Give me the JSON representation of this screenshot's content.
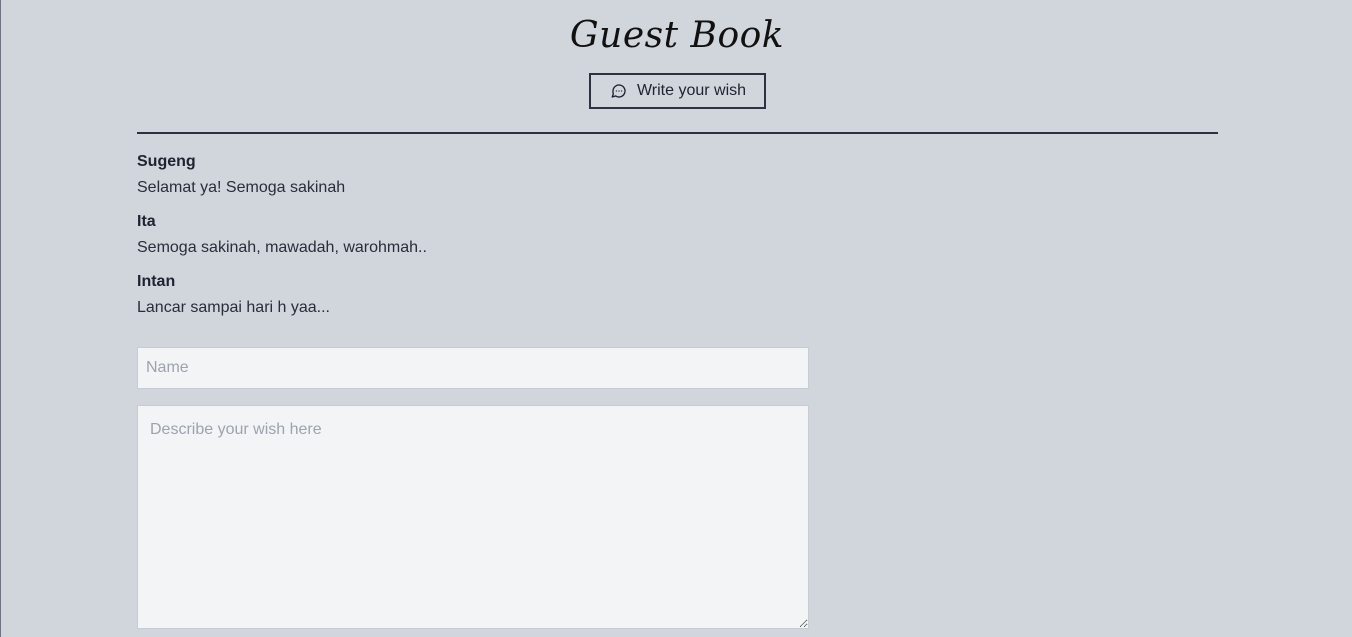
{
  "guestbook": {
    "title": "Guest Book",
    "write_button_label": "Write your wish",
    "write_button_icon": "chat-bubbles-icon"
  },
  "wishes": [
    {
      "name": "Sugeng",
      "message": "Selamat ya! Semoga sakinah"
    },
    {
      "name": "Ita",
      "message": "Semoga sakinah, mawadah, warohmah.."
    },
    {
      "name": "Intan",
      "message": "Lancar sampai hari h yaa..."
    }
  ],
  "form": {
    "name_placeholder": "Name",
    "name_value": "",
    "wish_placeholder": "Describe your wish here",
    "wish_value": ""
  },
  "colors": {
    "background": "#d1d5dc",
    "accent": "#2d3142",
    "input_background": "#f3f4f6"
  }
}
